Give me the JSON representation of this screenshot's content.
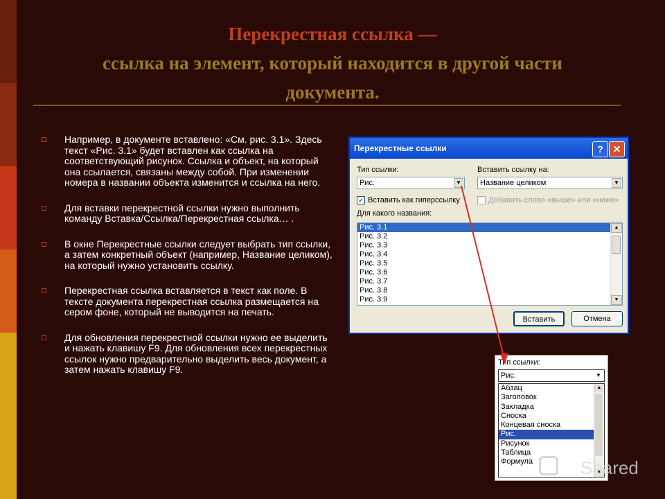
{
  "slide": {
    "title_line1": "Перекрестная ссылка —",
    "title_line2": "ссылка на элемент, который находится в другой части",
    "title_line3": "документа."
  },
  "bullets": [
    "Например, в документе вставлено: «См. рис. 3.1». Здесь текст «Рис. 3.1» будет вставлен как ссылка на соответствующий рисунок. Ссылка и объект, на который она ссылается, связаны между собой. При изменении номера в названии объекта изменится и ссылка на него.",
    "Для вставки перекрестной ссылки нужно выполнить команду Вставка/Ссылка/Перекрестная ссылка… .",
    "В окне Перекрестные ссылки следует выбрать тип ссылки, а затем конкретный объект (например, Название целиком), на который нужно установить ссылку.",
    "Перекрестная ссылка вставляется в текст как поле. В тексте документа перекрестная ссылка размещается на сером фоне, который не выводится на печать.",
    "Для обновления перекрестной ссылки нужно ее выделить и нажать клавишу F9. Для обновления всех перекрестных ссылок нужно предварительно выделить весь документ, а затем нажать клавишу F9."
  ],
  "dialog": {
    "title": "Перекрестные ссылки",
    "help_label": "?",
    "close_label": "✕",
    "type_label": "Тип ссылки:",
    "type_value": "Рис.",
    "insert_label": "Вставить ссылку на:",
    "insert_value": "Название целиком",
    "hyperlink_label": "Вставить как гиперссылку",
    "hyperlink_checked": "✓",
    "above_below_label": "Добавить слово «выше» или «ниже»",
    "which_label": "Для какого названия:",
    "items": [
      "Рис. 3.1",
      "Рис. 3.2",
      "Рис. 3.3",
      "Рис. 3.4",
      "Рис. 3.5",
      "Рис. 3.6",
      "Рис. 3.7",
      "Рис. 3.8",
      "Рис. 3.9"
    ],
    "insert_button": "Вставить",
    "cancel_button": "Отмена"
  },
  "dropdown": {
    "label": "Тип ссылки:",
    "value": "Рис.",
    "options": [
      "Абзац",
      "Заголовок",
      "Закладка",
      "Сноска",
      "Концевая сноска",
      "Рис.",
      "Рисунок",
      "Таблица",
      "Формула"
    ],
    "selected": "Рис."
  },
  "watermark": {
    "text": "Shared"
  },
  "icons": {
    "scroll_up": "▲",
    "scroll_down": "▼",
    "combo_arrow": "▼"
  },
  "colors": {
    "background": "#2a0a07",
    "title_accent": "#c0401b",
    "title_secondary": "#9a7b22",
    "selection": "#316ac5"
  }
}
